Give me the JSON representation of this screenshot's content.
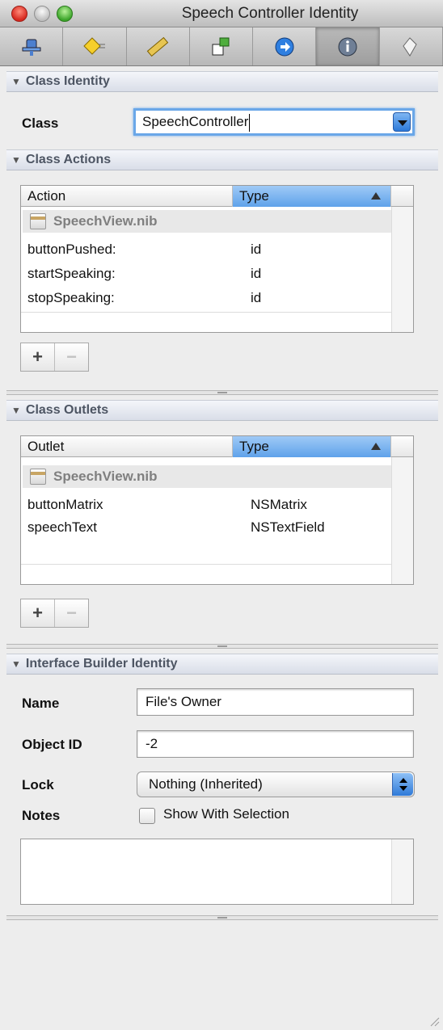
{
  "window": {
    "title": "Speech Controller Identity"
  },
  "toolbar": {
    "tabs": [
      {
        "icon": "connections-inspector-icon"
      },
      {
        "icon": "attributes-inspector-icon"
      },
      {
        "icon": "size-inspector-icon"
      },
      {
        "icon": "bindings-inspector-icon"
      },
      {
        "icon": "effects-inspector-icon"
      },
      {
        "icon": "identity-inspector-icon",
        "active": true
      },
      {
        "icon": "applescript-inspector-icon"
      }
    ]
  },
  "class_identity": {
    "header": "Class Identity",
    "class_label": "Class",
    "class_value": "SpeechController"
  },
  "class_actions": {
    "header": "Class Actions",
    "col_action": "Action",
    "col_type": "Type",
    "group": "SpeechView.nib",
    "rows": [
      {
        "name": "buttonPushed:",
        "type": "id"
      },
      {
        "name": "startSpeaking:",
        "type": "id"
      },
      {
        "name": "stopSpeaking:",
        "type": "id"
      }
    ]
  },
  "class_outlets": {
    "header": "Class Outlets",
    "col_outlet": "Outlet",
    "col_type": "Type",
    "group": "SpeechView.nib",
    "rows": [
      {
        "name": "buttonMatrix",
        "type": "NSMatrix"
      },
      {
        "name": "speechText",
        "type": "NSTextField"
      }
    ]
  },
  "buttons": {
    "add": "+",
    "remove": "−"
  },
  "ib_identity": {
    "header": "Interface Builder Identity",
    "name_label": "Name",
    "name_value": "File's Owner",
    "objectid_label": "Object ID",
    "objectid_value": "-2",
    "lock_label": "Lock",
    "lock_value": "Nothing (Inherited)",
    "notes_label": "Notes",
    "show_with_selection": "Show With Selection",
    "notes_text": ""
  }
}
